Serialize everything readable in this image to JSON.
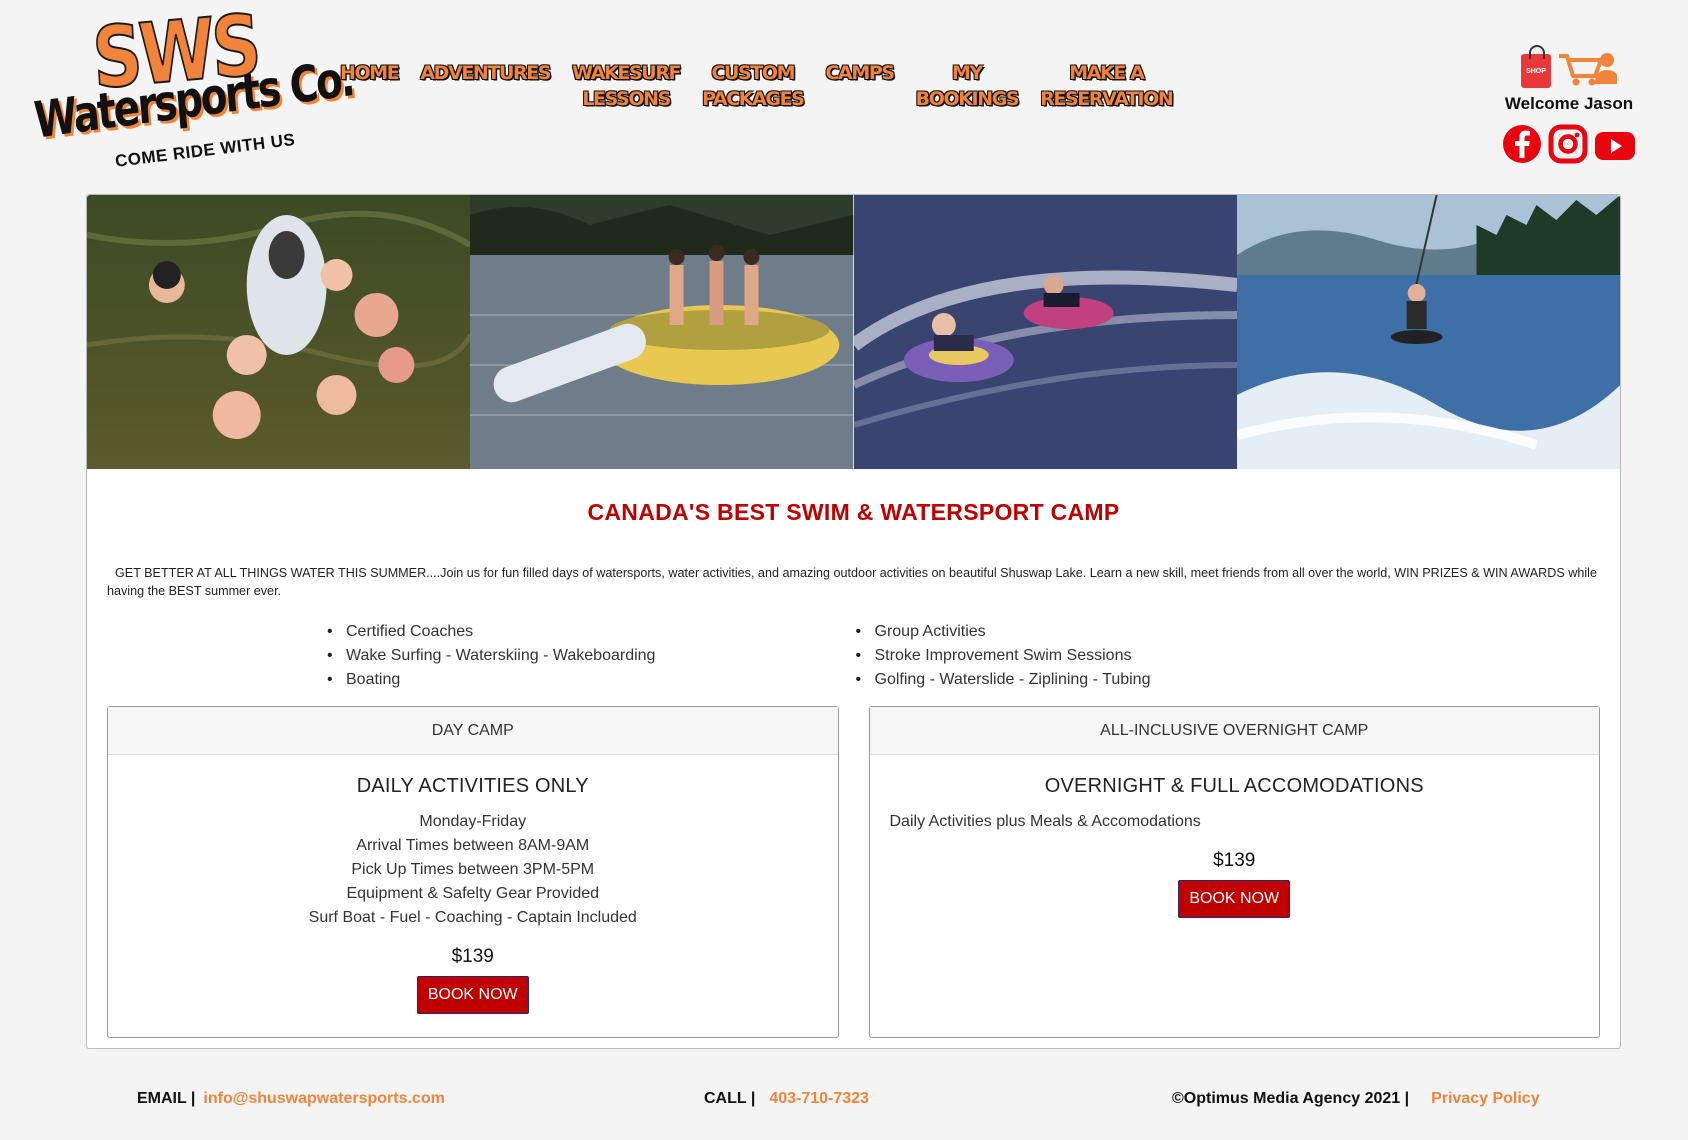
{
  "logo": {
    "line1": "SWS",
    "line2": "Watersports Co.",
    "tagline": "COME RIDE WITH US"
  },
  "nav": [
    {
      "label": "HOME"
    },
    {
      "label": "ADVENTURES"
    },
    {
      "label": "WAKESURF\nLESSONS"
    },
    {
      "label": "CUSTOM\nPACKAGES"
    },
    {
      "label": "CAMPS"
    },
    {
      "label": "MY\nBOOKINGS"
    },
    {
      "label": "MAKE A\nRESERVATION"
    }
  ],
  "user": {
    "shop_label": "SHOP",
    "welcome": "Welcome Jason",
    "icons": [
      "shop-bag-icon",
      "cart-icon",
      "user-icon",
      "facebook-icon",
      "instagram-icon",
      "youtube-icon"
    ]
  },
  "main": {
    "title": "CANADA'S BEST SWIM & WATERSPORT CAMP",
    "intro": "GET BETTER AT ALL THINGS WATER THIS SUMMER....Join us for fun filled days of watersports, water activities, and amazing outdoor activities on beautiful Shuswap Lake. Learn a new skill, meet friends from all over the world, WIN PRIZES & WIN AWARDS while having the BEST summer ever.",
    "features_left": [
      "Certified Coaches",
      "Wake Surfing - Waterskiing - Wakeboarding",
      "Boating"
    ],
    "features_right": [
      "Group Activities",
      "Stroke Improvement Swim Sessions",
      "Golfing - Waterslide - Ziplining - Tubing"
    ],
    "plans": [
      {
        "header": "DAY CAMP",
        "subtitle": "DAILY ACTIVITIES ONLY",
        "lines": [
          "Monday-Friday",
          "Arrival Times between 8AM-9AM",
          "Pick Up Times between 3PM-5PM",
          "Equipment & Safelty Gear Provided",
          "Surf Boat - Fuel - Coaching - Captain Included"
        ],
        "price": "$139",
        "button": "BOOK NOW"
      },
      {
        "header": "ALL-INCLUSIVE OVERNIGHT CAMP",
        "subtitle": "OVERNIGHT & FULL ACCOMODATIONS",
        "description": "Daily Activities plus Meals & Accomodations",
        "price": "$139",
        "button": "BOOK NOW"
      }
    ]
  },
  "footer": {
    "email_label": "EMAIL |",
    "email": "info@shuswapwatersports.com",
    "call_label": "CALL |",
    "phone": "403-710-7323",
    "copyright": "©Optimus Media Agency 2021 |",
    "privacy": "Privacy Policy"
  },
  "colors": {
    "accent": "#f2833a",
    "brand_red": "#c00000",
    "background": "#f4f4f4"
  }
}
